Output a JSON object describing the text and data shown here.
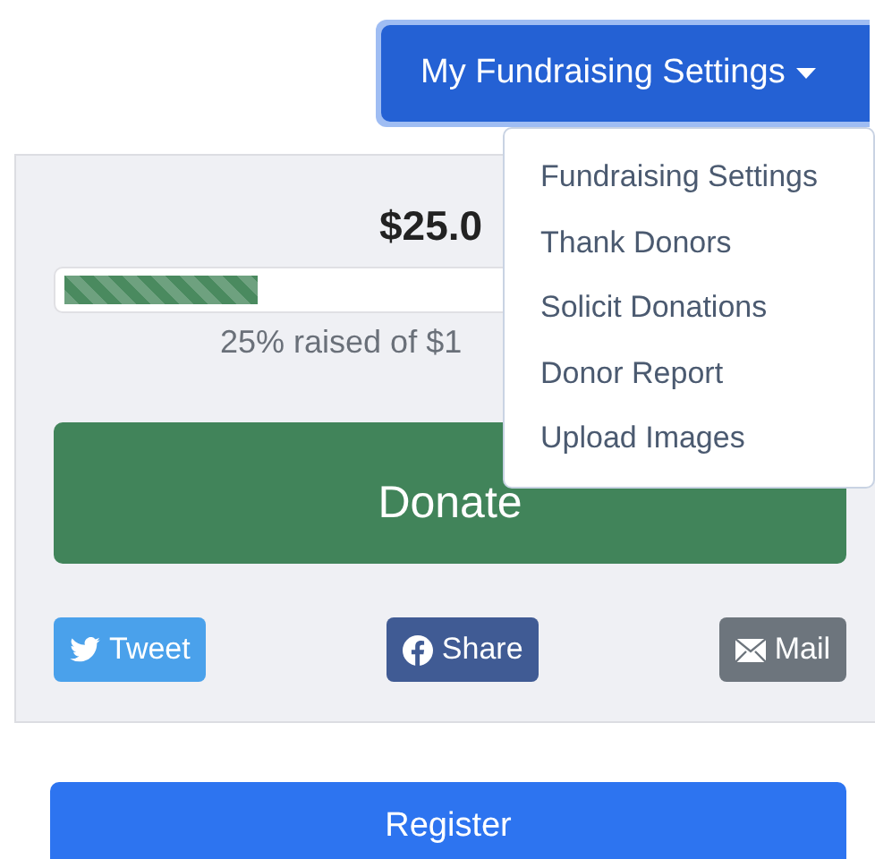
{
  "settings_dropdown": {
    "label": "My Fundraising Settings",
    "expanded": true,
    "items": [
      {
        "label": "Fundraising Settings"
      },
      {
        "label": "Thank Donors"
      },
      {
        "label": "Solicit Donations"
      },
      {
        "label": "Donor Report"
      },
      {
        "label": "Upload Images"
      }
    ]
  },
  "campaign": {
    "amount": "$25.0",
    "progress": {
      "level": 0.25,
      "caption": "25% raised of $1"
    },
    "donate_button": "Donate",
    "share_buttons": [
      {
        "kind": "twitter",
        "label": "Tweet"
      },
      {
        "kind": "facebook",
        "label": "Share"
      },
      {
        "kind": "mail",
        "label": "Mail"
      }
    ]
  },
  "register_button": "Register"
}
